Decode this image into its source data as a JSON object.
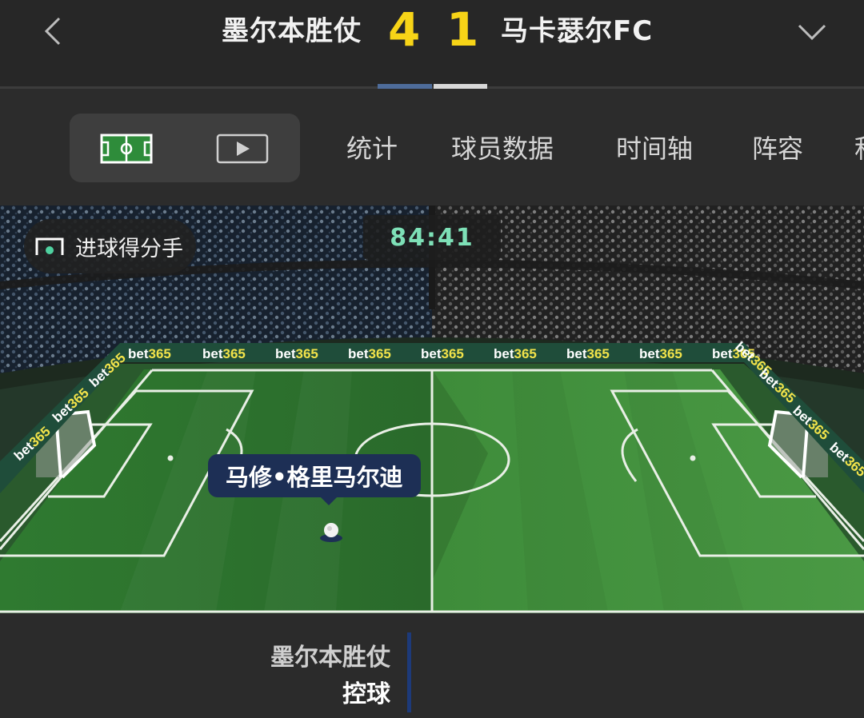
{
  "header": {
    "home_team": "墨尔本胜仗",
    "away_team": "马卡瑟尔FC",
    "home_score": "4",
    "away_score": "1",
    "back_icon": "chevron-left-icon",
    "expand_icon": "chevron-down-icon"
  },
  "tabs": [
    {
      "label": "统计"
    },
    {
      "label": "球员数据"
    },
    {
      "label": "时间轴"
    },
    {
      "label": "阵容"
    },
    {
      "label": "积"
    }
  ],
  "view_toggle": {
    "pitch_icon": "pitch-view-icon",
    "video_icon": "video-play-icon"
  },
  "match": {
    "clock": "84:41",
    "scorer_chip_label": "进球得分手",
    "player_name": "马修•格里马尔迪",
    "sponsor": "bet365"
  },
  "event": {
    "team": "墨尔本胜仗",
    "action": "控球"
  },
  "colors": {
    "score": "#f7d417",
    "clock": "#7ee0b7",
    "player_tag": "#1d2f55",
    "pitch": "#3f8a3c",
    "sponsor_text": "#f2e34a"
  }
}
